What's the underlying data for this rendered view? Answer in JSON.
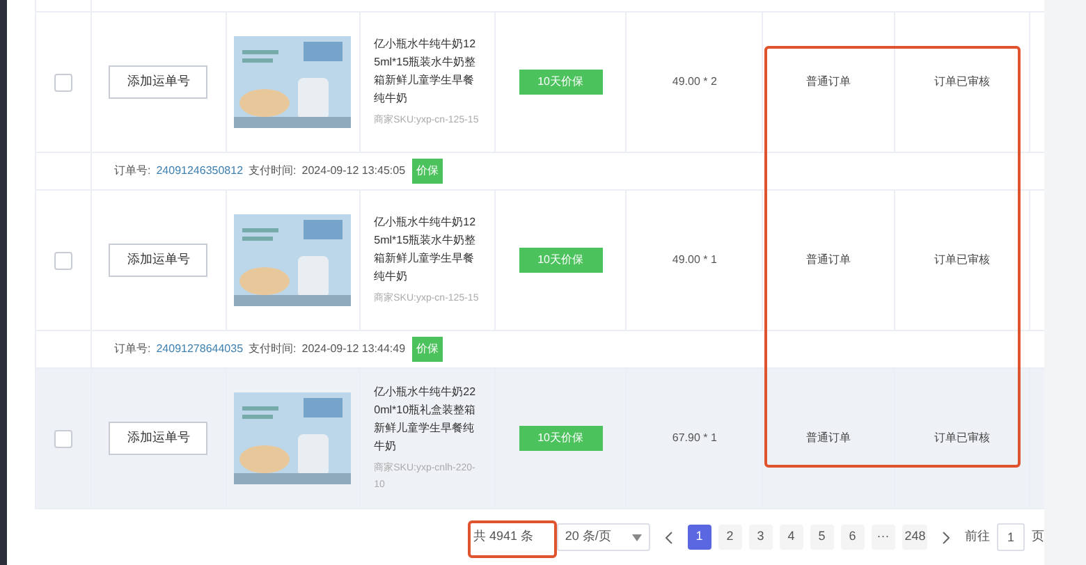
{
  "rows": [
    {
      "kind": "product",
      "waybill_button": "添加运单号",
      "name": "亿小瓶水牛纯牛奶125ml*15瓶装水牛奶整箱新鲜儿童学生早餐纯牛奶",
      "sku": "商家SKU:yxp-cn-125-15",
      "tag": "10天价保",
      "price": "49.00 * 2",
      "order_type": "普通订单",
      "status": "订单已审核",
      "selected": false,
      "checked": false
    },
    {
      "kind": "order_header",
      "label": "订单号:",
      "order_no": "24091246350812",
      "pay_label": "支付时间:",
      "pay_time": "2024-09-12 13:45:05",
      "badge": "价保"
    },
    {
      "kind": "product",
      "waybill_button": "添加运单号",
      "name": "亿小瓶水牛纯牛奶125ml*15瓶装水牛奶整箱新鲜儿童学生早餐纯牛奶",
      "sku": "商家SKU:yxp-cn-125-15",
      "tag": "10天价保",
      "price": "49.00 * 1",
      "order_type": "普通订单",
      "status": "订单已审核",
      "selected": false,
      "checked": false
    },
    {
      "kind": "order_header",
      "label": "订单号:",
      "order_no": "24091278644035",
      "pay_label": "支付时间:",
      "pay_time": "2024-09-12 13:44:49",
      "badge": "价保"
    },
    {
      "kind": "product",
      "waybill_button": "添加运单号",
      "name": "亿小瓶水牛纯牛奶220ml*10瓶礼盒装整箱新鲜儿童学生早餐纯牛奶",
      "sku": "商家SKU:yxp-cnlh-220-10",
      "tag": "10天价保",
      "price": "67.90 * 1",
      "order_type": "普通订单",
      "status": "订单已审核",
      "selected": true,
      "checked": false
    }
  ],
  "pagination": {
    "total": "共 4941 条",
    "page_size": "20 条/页",
    "pages": [
      {
        "label": "1",
        "selected": true
      },
      {
        "label": "2",
        "selected": false
      },
      {
        "label": "3",
        "selected": false
      },
      {
        "label": "4",
        "selected": false
      },
      {
        "label": "5",
        "selected": false
      },
      {
        "label": "6",
        "selected": false
      },
      {
        "label": "···",
        "selected": false
      },
      {
        "label": "248",
        "selected": false
      }
    ],
    "goto_label": "前往",
    "goto_value": "1",
    "goto_suffix": "页"
  }
}
